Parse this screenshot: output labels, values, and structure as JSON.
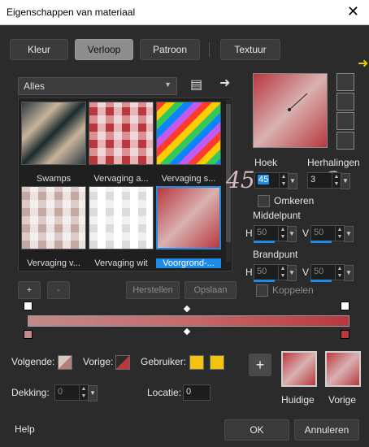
{
  "window": {
    "title": "Eigenschappen van materiaal"
  },
  "tabs": [
    {
      "label": "Kleur"
    },
    {
      "label": "Verloop"
    },
    {
      "label": "Patroon"
    },
    {
      "label": "Textuur"
    }
  ],
  "category_select": {
    "value": "Alles"
  },
  "gallery": [
    {
      "label": "Swamps"
    },
    {
      "label": "Vervaging a..."
    },
    {
      "label": "Vervaging s..."
    },
    {
      "label": "Vervaging v..."
    },
    {
      "label": "Vervaging wit"
    },
    {
      "label": "Voorgrond-..."
    }
  ],
  "gradient_buttons": {
    "add": "+",
    "remove": "-",
    "reset": "Herstellen",
    "save": "Opslaan"
  },
  "params": {
    "angle_label": "Hoek",
    "angle_value": "45",
    "repeats_label": "Herhalingen",
    "repeats_value": "3",
    "invert_label": "Omkeren",
    "center_label": "Middelpunt",
    "h_label": "H",
    "v_label": "V",
    "center_h": "50",
    "center_v": "50",
    "focal_label": "Brandpunt",
    "focal_h": "50",
    "focal_v": "50",
    "link_label": "Koppelen"
  },
  "annotations": {
    "angle": "45",
    "repeats": "3"
  },
  "bottom": {
    "next_label": "Volgende:",
    "prev_label": "Vorige:",
    "user_label": "Gebruiker:",
    "opacity_label": "Dekking:",
    "opacity_value": "0",
    "location_label": "Locatie:",
    "location_value": "0",
    "current_label": "Huidige",
    "previous_label": "Vorige"
  },
  "footer": {
    "help": "Help",
    "ok": "OK",
    "cancel": "Annuleren"
  },
  "colors": {
    "accent": "#1e8be6",
    "gradient_start": "#c18b89",
    "gradient_end": "#b8383e",
    "user_swatch": "#f1c40f"
  }
}
